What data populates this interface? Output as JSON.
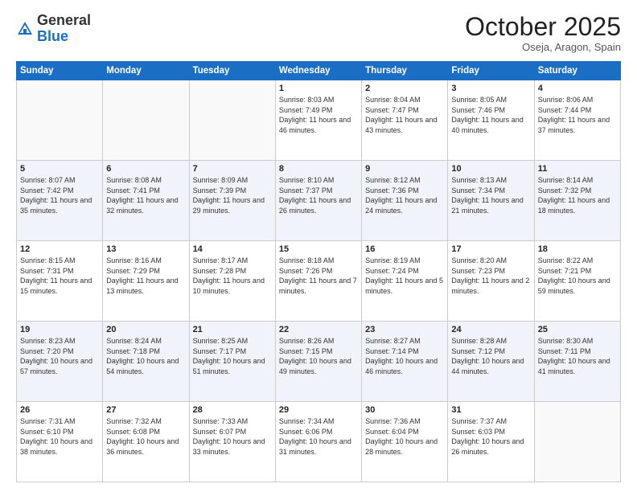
{
  "header": {
    "logo_general": "General",
    "logo_blue": "Blue",
    "month": "October 2025",
    "location": "Oseja, Aragon, Spain"
  },
  "days_of_week": [
    "Sunday",
    "Monday",
    "Tuesday",
    "Wednesday",
    "Thursday",
    "Friday",
    "Saturday"
  ],
  "weeks": [
    [
      {
        "day": "",
        "sunrise": "",
        "sunset": "",
        "daylight": ""
      },
      {
        "day": "",
        "sunrise": "",
        "sunset": "",
        "daylight": ""
      },
      {
        "day": "",
        "sunrise": "",
        "sunset": "",
        "daylight": ""
      },
      {
        "day": "1",
        "sunrise": "8:03 AM",
        "sunset": "7:49 PM",
        "daylight": "11 hours and 46 minutes."
      },
      {
        "day": "2",
        "sunrise": "8:04 AM",
        "sunset": "7:47 PM",
        "daylight": "11 hours and 43 minutes."
      },
      {
        "day": "3",
        "sunrise": "8:05 AM",
        "sunset": "7:46 PM",
        "daylight": "11 hours and 40 minutes."
      },
      {
        "day": "4",
        "sunrise": "8:06 AM",
        "sunset": "7:44 PM",
        "daylight": "11 hours and 37 minutes."
      }
    ],
    [
      {
        "day": "5",
        "sunrise": "8:07 AM",
        "sunset": "7:42 PM",
        "daylight": "11 hours and 35 minutes."
      },
      {
        "day": "6",
        "sunrise": "8:08 AM",
        "sunset": "7:41 PM",
        "daylight": "11 hours and 32 minutes."
      },
      {
        "day": "7",
        "sunrise": "8:09 AM",
        "sunset": "7:39 PM",
        "daylight": "11 hours and 29 minutes."
      },
      {
        "day": "8",
        "sunrise": "8:10 AM",
        "sunset": "7:37 PM",
        "daylight": "11 hours and 26 minutes."
      },
      {
        "day": "9",
        "sunrise": "8:12 AM",
        "sunset": "7:36 PM",
        "daylight": "11 hours and 24 minutes."
      },
      {
        "day": "10",
        "sunrise": "8:13 AM",
        "sunset": "7:34 PM",
        "daylight": "11 hours and 21 minutes."
      },
      {
        "day": "11",
        "sunrise": "8:14 AM",
        "sunset": "7:32 PM",
        "daylight": "11 hours and 18 minutes."
      }
    ],
    [
      {
        "day": "12",
        "sunrise": "8:15 AM",
        "sunset": "7:31 PM",
        "daylight": "11 hours and 15 minutes."
      },
      {
        "day": "13",
        "sunrise": "8:16 AM",
        "sunset": "7:29 PM",
        "daylight": "11 hours and 13 minutes."
      },
      {
        "day": "14",
        "sunrise": "8:17 AM",
        "sunset": "7:28 PM",
        "daylight": "11 hours and 10 minutes."
      },
      {
        "day": "15",
        "sunrise": "8:18 AM",
        "sunset": "7:26 PM",
        "daylight": "11 hours and 7 minutes."
      },
      {
        "day": "16",
        "sunrise": "8:19 AM",
        "sunset": "7:24 PM",
        "daylight": "11 hours and 5 minutes."
      },
      {
        "day": "17",
        "sunrise": "8:20 AM",
        "sunset": "7:23 PM",
        "daylight": "11 hours and 2 minutes."
      },
      {
        "day": "18",
        "sunrise": "8:22 AM",
        "sunset": "7:21 PM",
        "daylight": "10 hours and 59 minutes."
      }
    ],
    [
      {
        "day": "19",
        "sunrise": "8:23 AM",
        "sunset": "7:20 PM",
        "daylight": "10 hours and 57 minutes."
      },
      {
        "day": "20",
        "sunrise": "8:24 AM",
        "sunset": "7:18 PM",
        "daylight": "10 hours and 54 minutes."
      },
      {
        "day": "21",
        "sunrise": "8:25 AM",
        "sunset": "7:17 PM",
        "daylight": "10 hours and 51 minutes."
      },
      {
        "day": "22",
        "sunrise": "8:26 AM",
        "sunset": "7:15 PM",
        "daylight": "10 hours and 49 minutes."
      },
      {
        "day": "23",
        "sunrise": "8:27 AM",
        "sunset": "7:14 PM",
        "daylight": "10 hours and 46 minutes."
      },
      {
        "day": "24",
        "sunrise": "8:28 AM",
        "sunset": "7:12 PM",
        "daylight": "10 hours and 44 minutes."
      },
      {
        "day": "25",
        "sunrise": "8:30 AM",
        "sunset": "7:11 PM",
        "daylight": "10 hours and 41 minutes."
      }
    ],
    [
      {
        "day": "26",
        "sunrise": "7:31 AM",
        "sunset": "6:10 PM",
        "daylight": "10 hours and 38 minutes."
      },
      {
        "day": "27",
        "sunrise": "7:32 AM",
        "sunset": "6:08 PM",
        "daylight": "10 hours and 36 minutes."
      },
      {
        "day": "28",
        "sunrise": "7:33 AM",
        "sunset": "6:07 PM",
        "daylight": "10 hours and 33 minutes."
      },
      {
        "day": "29",
        "sunrise": "7:34 AM",
        "sunset": "6:06 PM",
        "daylight": "10 hours and 31 minutes."
      },
      {
        "day": "30",
        "sunrise": "7:36 AM",
        "sunset": "6:04 PM",
        "daylight": "10 hours and 28 minutes."
      },
      {
        "day": "31",
        "sunrise": "7:37 AM",
        "sunset": "6:03 PM",
        "daylight": "10 hours and 26 minutes."
      },
      {
        "day": "",
        "sunrise": "",
        "sunset": "",
        "daylight": ""
      }
    ]
  ],
  "labels": {
    "sunrise_prefix": "Sunrise: ",
    "sunset_prefix": "Sunset: ",
    "daylight_prefix": "Daylight: "
  }
}
